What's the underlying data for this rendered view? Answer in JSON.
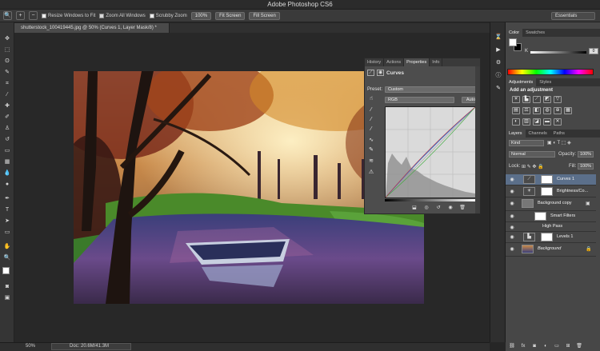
{
  "app": {
    "title": "Adobe Photoshop CS6"
  },
  "options": {
    "resize_windows": "Resize Windows to Fit",
    "zoom_all": "Zoom All Windows",
    "scrubby_zoom": "Scrubby Zoom",
    "zoom_value": "100%",
    "fit_screen": "Fit Screen",
    "fill_screen": "Fill Screen",
    "workspace": "Essentials"
  },
  "document": {
    "tab": "shutterstock_100419445.jpg @ 50% (Curves 1, Layer Mask/8) *"
  },
  "status": {
    "zoom": "50%",
    "doc_size": "Doc: 20.6M/41.3M"
  },
  "properties": {
    "tabs": [
      "History",
      "Actions",
      "Properties",
      "Info"
    ],
    "active_tab": "Properties",
    "title": "Curves",
    "preset_label": "Preset:",
    "preset_value": "Custom",
    "channel": "RGB",
    "auto_label": "Auto"
  },
  "color_panel": {
    "tabs": [
      "Color",
      "Swatches"
    ],
    "channel_label": "K",
    "channel_value": "0"
  },
  "adjustments_panel": {
    "tabs": [
      "Adjustments",
      "Styles"
    ],
    "title": "Add an adjustment"
  },
  "layers_panel": {
    "tabs": [
      "Layers",
      "Channels",
      "Paths"
    ],
    "kind": "Kind",
    "blend_mode": "Normal",
    "opacity_label": "Opacity:",
    "opacity_value": "100%",
    "lock_label": "Lock:",
    "fill_label": "Fill:",
    "fill_value": "100%",
    "layers": [
      {
        "name": "Curves 1"
      },
      {
        "name": "Brightness/Co..."
      },
      {
        "name": "Background copy"
      },
      {
        "name": "Smart Filters"
      },
      {
        "name": "High Pass"
      },
      {
        "name": "Levels 1"
      },
      {
        "name": "Background"
      }
    ]
  },
  "icons": [
    "zoom-icon",
    "eye-icon",
    "lock-icon",
    "link-icon",
    "fx-icon",
    "mask-icon",
    "trash-icon",
    "new-layer-icon",
    "folder-icon"
  ],
  "colors": {
    "selected_layer": "#5b6f8a",
    "panel_bg": "#474747",
    "app_bg": "#262626"
  }
}
